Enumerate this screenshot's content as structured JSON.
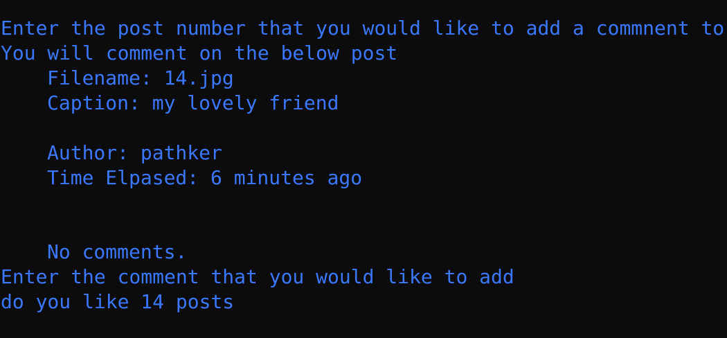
{
  "terminal": {
    "text_color": "#3b78ff",
    "background_color": "#0c0c0c",
    "prompt_post_number": "Enter the post number that you would like to add a commnent to",
    "comment_target_notice": "You will comment on the below post",
    "post": {
      "filename_line": "Filename: 14.jpg",
      "caption_line": "Caption: my lovely friend",
      "author_line": "Author: pathker",
      "time_elapsed_line": "Time Elpased: 6 minutes ago",
      "comments_line": "No comments."
    },
    "prompt_comment": "Enter the comment that you would like to add",
    "user_input": "do you like 14 posts"
  }
}
